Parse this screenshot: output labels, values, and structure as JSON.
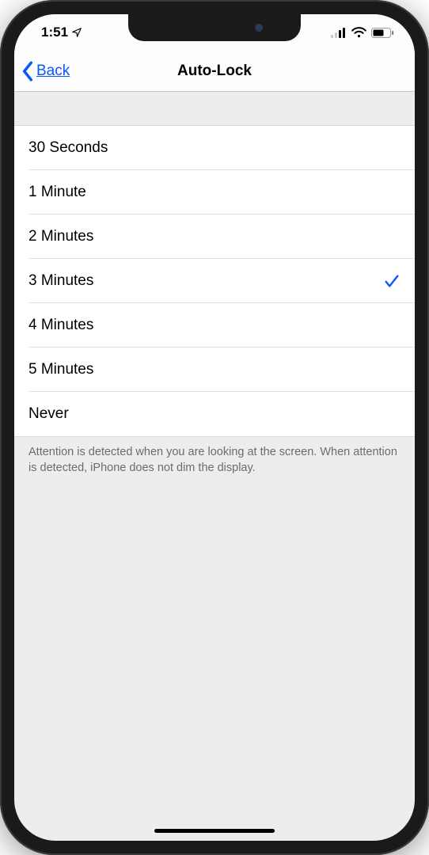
{
  "status": {
    "time": "1:51"
  },
  "nav": {
    "back_label": "Back",
    "title": "Auto-Lock"
  },
  "options": [
    {
      "label": "30 Seconds",
      "selected": false
    },
    {
      "label": "1 Minute",
      "selected": false
    },
    {
      "label": "2 Minutes",
      "selected": false
    },
    {
      "label": "3 Minutes",
      "selected": true
    },
    {
      "label": "4 Minutes",
      "selected": false
    },
    {
      "label": "5 Minutes",
      "selected": false
    },
    {
      "label": "Never",
      "selected": false
    }
  ],
  "footer": "Attention is detected when you are looking at the screen. When attention is detected, iPhone does not dim the display."
}
